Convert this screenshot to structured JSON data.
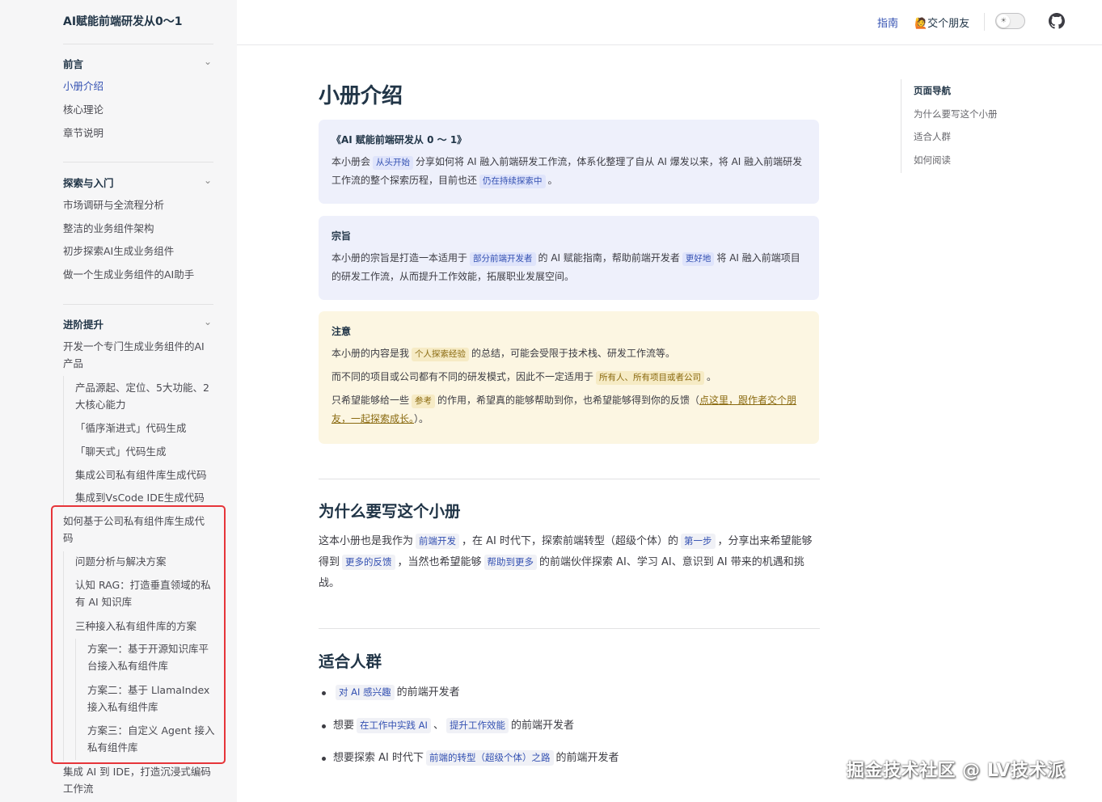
{
  "sidebar": {
    "title": "AI赋能前端研发从0～1",
    "groups": [
      {
        "title": "前言",
        "items": [
          "小册介绍",
          "核心理论",
          "章节说明"
        ]
      },
      {
        "title": "探索与入门",
        "items": [
          "市场调研与全流程分析",
          "整洁的业务组件架构",
          "初步探索AI生成业务组件",
          "做一个生成业务组件的AI助手"
        ]
      },
      {
        "title": "进阶提升"
      }
    ],
    "advanced": {
      "item1": "开发一个专门生成业务组件的AI产品",
      "sub1": "产品源起、定位、5大功能、2大核心能力",
      "sub2": "「循序渐进式」代码生成",
      "sub3": "「聊天式」代码生成",
      "sub4": "集成公司私有组件库生成代码",
      "sub5": "集成到VsCode IDE生成代码",
      "item2": "如何基于公司私有组件库生成代码",
      "sub6": "问题分析与解决方案",
      "sub7": "认知 RAG：打造垂直领域的私有 AI 知识库",
      "sub8": "三种接入私有组件库的方案",
      "plan1": "方案一：基于开源知识库平台接入私有组件库",
      "plan2": "方案二：基于 LlamaIndex 接入私有组件库",
      "plan3": "方案三：自定义 Agent 接入私有组件库",
      "item3": "集成 AI 到 IDE，打造沉浸式编码工作流"
    }
  },
  "nav": {
    "guide": "指南",
    "friend": "🙋交个朋友",
    "theme_icon": "sun-icon",
    "github_icon": "github-icon"
  },
  "main": {
    "title": "小册介绍",
    "intro": {
      "title": "《AI 赋能前端研发从 0 ～ 1》",
      "t1": "本小册会",
      "tag1": "从头开始",
      "t2": "分享如何将 AI 融入前端研发工作流，体系化整理了自从 AI 爆发以来，将 AI 融入前端研发工作流的整个探索历程，目前也还",
      "tag2": "仍在持续探索中",
      "t3": "。"
    },
    "purpose": {
      "title": "宗旨",
      "t1": "本小册的宗旨是打造一本适用于",
      "tag1": "部分前端开发者",
      "t2": "的 AI 赋能指南，帮助前端开发者",
      "tag2": "更好地",
      "t3": "将 AI 融入前端项目的研发工作流，从而提升工作效能，拓展职业发展空间。"
    },
    "notice": {
      "title": "注意",
      "l1a": "本小册的内容是我",
      "l1tag": "个人探索经验",
      "l1b": "的总结，可能会受限于技术栈、研发工作流等。",
      "l2a": "而不同的项目或公司都有不同的研发模式，因此不一定适用于",
      "l2tag": "所有人、所有项目或者公司",
      "l2b": "。",
      "l3a": "只希望能够给一些",
      "l3tag": "参考",
      "l3b": "的作用，希望真的能够帮助到你，也希望能够得到你的反馈（",
      "l3link": "点这里，跟作者交个朋友，一起探索成长。",
      "l3c": "）。"
    },
    "why": {
      "heading": "为什么要写这个小册",
      "a": "这本小册也是我作为",
      "tag1": "前端开发",
      "b": "，在 AI 时代下，探索前端转型（超级个体）的",
      "tag2": "第一步",
      "c": "，分享出来希望能够得到",
      "tag3": "更多的反馈",
      "d": "，当然也希望能够",
      "tag4": "帮助到更多",
      "e": "的前端伙伴探索 AI、学习 AI、意识到 AI 带来的机遇和挑战。"
    },
    "audience": {
      "heading": "适合人群",
      "b1tag": "对 AI 感兴趣",
      "b1": "的前端开发者",
      "b2a": "想要",
      "b2tag1": "在工作中实践 AI",
      "b2sep": "、",
      "b2tag2": "提升工作效能",
      "b2b": "的前端开发者",
      "b3a": "想要探索 AI 时代下",
      "b3tag": "前端的转型（超级个体）之路",
      "b3b": "的前端开发者"
    }
  },
  "outline": {
    "title": "页面导航",
    "items": [
      "为什么要写这个小册",
      "适合人群",
      "如何阅读"
    ]
  },
  "watermark": "掘金技术社区 @ LV技术派"
}
